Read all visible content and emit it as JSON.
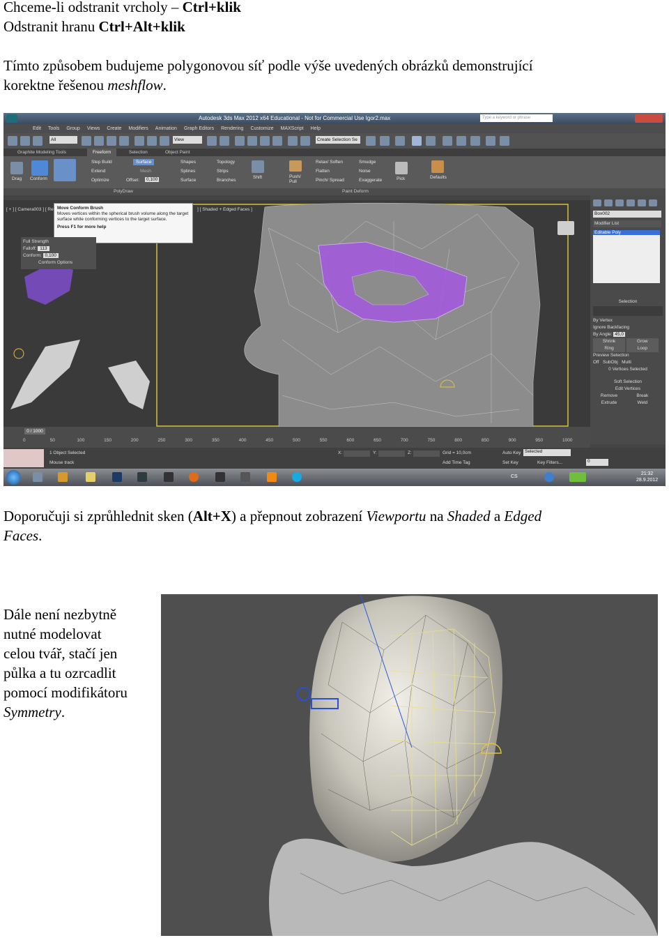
{
  "doc": {
    "line1": {
      "plain": "Chceme-li odstranit vrcholy – ",
      "bold": "Ctrl+klik"
    },
    "line2": {
      "plain": "Odstranit hranu ",
      "bold": "Ctrl+Alt+klik"
    },
    "para1": {
      "line1": "Tímto způsobem budujeme polygonovou síť podle výše uvedených obrázků demonstrující",
      "line2_plain": "korektne řešenou ",
      "line2_italic": "meshflow",
      "line2_end": "."
    },
    "para2": {
      "a": "Doporučuji si zprůhlednit sken (",
      "b_bold": "Alt+X",
      "c": ") a přepnout zobrazení ",
      "d_italic": "Viewportu",
      "e": " na ",
      "f_italic": "Shaded",
      "g": " a ",
      "h_italic": "Edged",
      "line2_italic": "Faces",
      "line2_end": "."
    },
    "para3": {
      "l1": "Dále není nezbytně",
      "l2": "nutné modelovat",
      "l3": "celou tvář, stačí jen",
      "l4": "půlka a tu ozrcadlit",
      "l5": "pomocí modifikátoru",
      "l6_italic": "Symmetry",
      "l6_end": "."
    }
  },
  "screenshot": {
    "title": "Autodesk 3ds Max 2012 x64    Educational - Not for Commercial Use    Igor2.max",
    "search_placeholder": "Type a keyword or phrase",
    "menu": [
      "Edit",
      "Tools",
      "Group",
      "Views",
      "Create",
      "Modifiers",
      "Animation",
      "Graph Editors",
      "Rendering",
      "Customize",
      "MAXScript",
      "Help"
    ],
    "toolbar": {
      "filter": "All",
      "view": "View",
      "named_selection": "Create Selection Se"
    },
    "ribbon_tabs": [
      "Graphite Modeling Tools",
      "Freeform",
      "Selection",
      "Object Paint"
    ],
    "ribbon": {
      "drag": "Drag",
      "conform": "Conform",
      "step_build": "Step Build",
      "extend": "Extend",
      "optimize": "Optimize",
      "surface_btn": "Surface",
      "mesh": "Mesh",
      "offset_label": "Offset:",
      "offset_value": "0,100",
      "shapes": "Shapes",
      "splines": "Splines",
      "surface": "Surface",
      "topology": "Topology",
      "strips": "Strips",
      "branches": "Branches",
      "shift": "Shift",
      "relax_soften": "Relax/ Soften",
      "flatten": "Flatten",
      "pinch_spread": "Pinch/ Spread",
      "smudge": "Smudge",
      "noise": "Noise",
      "exaggerate": "Exaggerate",
      "push_pull": "Push/ Pull",
      "pick": "Pick",
      "defaults": "Defaults",
      "polydraw": "PolyDraw",
      "paint_deform": "Paint Deform"
    },
    "viewport_label": "[ + ] [ Camera003 ] [ Re",
    "viewport_label_right": "] [ Shaded + Edged Faces ]",
    "tooltip": {
      "title": "Move Conform Brush",
      "body": "Moves vertices within the spherical brush volume along the target surface while conforming vertices to the target surface.",
      "help": "Press F1 for more help"
    },
    "conform_panel": {
      "full_strength": "Full Strength",
      "falloff_label": "Falloff:",
      "falloff_value": "113",
      "conform_label": "Conform:",
      "conform_value": "0,100",
      "options": "Conform Options"
    },
    "command_panel": {
      "object_name": "Box002",
      "modifier_list": "Modifier List",
      "stack_item": "Editable Poly",
      "selection_title": "Selection",
      "by_vertex": "By Vertex",
      "ignore_backfacing": "Ignore Backfacing",
      "by_angle": "By Angle:",
      "angle_value": "45,0",
      "shrink": "Shrink",
      "grow": "Grow",
      "ring": "Ring",
      "loop": "Loop",
      "preview_selection": "Preview Selection",
      "off": "Off",
      "subobj": "SubObj",
      "multi": "Multi",
      "selected_count": "0 Vertices Selected",
      "soft_selection": "Soft Selection",
      "edit_vertices": "Edit Vertices",
      "remove": "Remove",
      "break": "Break",
      "extrude": "Extrude",
      "weld": "Weld"
    },
    "time": {
      "frame": "0 / 1000",
      "ticks": [
        "0",
        "50",
        "100",
        "150",
        "200",
        "250",
        "300",
        "350",
        "400",
        "450",
        "500",
        "550",
        "600",
        "650",
        "700",
        "750",
        "800",
        "850",
        "900",
        "950",
        "1000"
      ]
    },
    "status": {
      "selected": "1 Object Selected",
      "hint": "Mouse track",
      "x": "X:",
      "y": "Y:",
      "z": "Z:",
      "grid": "Grid = 10,0cm",
      "add_time_tag": "Add Time Tag",
      "auto_key": "Auto Key",
      "selected_mode": "Selected",
      "set_key": "Set Key",
      "key_filters": "Key Filters...",
      "frame_field": "0"
    },
    "taskbar": {
      "lang": "CS",
      "clock": "21:32",
      "date": "28.9.2012"
    }
  },
  "colors": {
    "accent_purple": "#a35cdc",
    "wire_yellow": "#e9df8a",
    "viewport_border": "#d7c23a"
  }
}
